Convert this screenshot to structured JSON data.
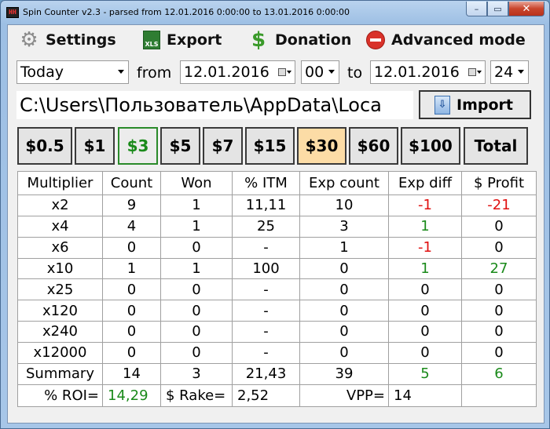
{
  "window": {
    "app_icon_text": "HH",
    "title": "Spin Counter v2.3 - parsed from 12.01.2016 0:00:00 to 13.01.2016 0:00:00",
    "minimize": "–",
    "maximize": "▭",
    "close": "✕"
  },
  "menu": {
    "settings": "Settings",
    "export": "Export",
    "export_icon_text": "XLS",
    "donation": "Donation",
    "advanced": "Advanced mode"
  },
  "filter": {
    "period": "Today",
    "from_label": "from",
    "from_date": "12.01.2016",
    "from_hour": "00",
    "to_label": "to",
    "to_date": "12.01.2016",
    "to_hour": "24"
  },
  "path": {
    "value": "C:\\Users\\Пользователь\\AppData\\Loca",
    "import_label": "Import"
  },
  "stakes": [
    "$0.5",
    "$1",
    "$3",
    "$5",
    "$7",
    "$15",
    "$30",
    "$60",
    "$100",
    "Total"
  ],
  "stakes_state": {
    "selected": "$3",
    "highlighted": "$30"
  },
  "colors": {
    "negative": "#e01010",
    "positive": "#1a8a1a",
    "highlight": "#fcdca6"
  },
  "table": {
    "headers": [
      "Multiplier",
      "Count",
      "Won",
      "% ITM",
      "Exp count",
      "Exp diff",
      "$ Profit"
    ],
    "rows": [
      [
        "x2",
        "9",
        "1",
        "11,11",
        "10",
        "-1",
        "-21"
      ],
      [
        "x4",
        "4",
        "1",
        "25",
        "3",
        "1",
        "0"
      ],
      [
        "x6",
        "0",
        "0",
        "-",
        "1",
        "-1",
        "0"
      ],
      [
        "x10",
        "1",
        "1",
        "100",
        "0",
        "1",
        "27"
      ],
      [
        "x25",
        "0",
        "0",
        "-",
        "0",
        "0",
        "0"
      ],
      [
        "x120",
        "0",
        "0",
        "-",
        "0",
        "0",
        "0"
      ],
      [
        "x240",
        "0",
        "0",
        "-",
        "0",
        "0",
        "0"
      ],
      [
        "x12000",
        "0",
        "0",
        "-",
        "0",
        "0",
        "0"
      ],
      [
        "Summary",
        "14",
        "3",
        "21,43",
        "39",
        "5",
        "6"
      ]
    ],
    "footer": {
      "roi_label": "% ROI=",
      "roi_value": "14,29",
      "rake_label": "$ Rake=",
      "rake_value": "2,52",
      "vpp_label": "VPP=",
      "vpp_value": "14"
    }
  }
}
